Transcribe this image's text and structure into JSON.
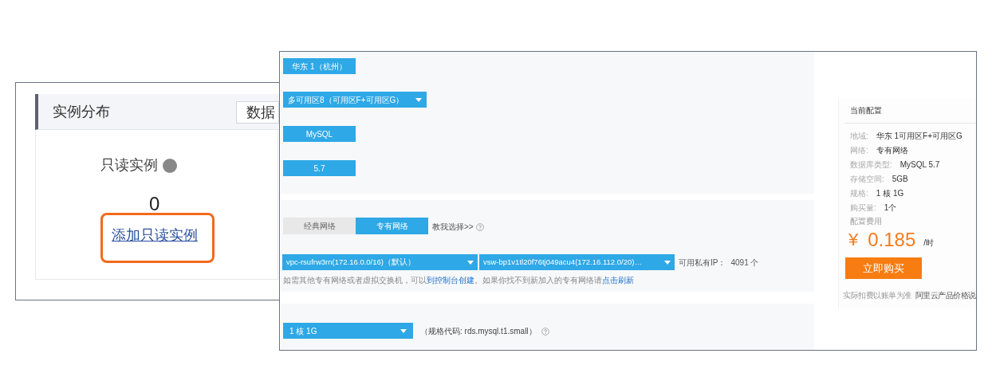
{
  "left_panel": {
    "title": "实例分布",
    "tab_partial": "数据",
    "readonly_label": "只读实例",
    "readonly_count": "0",
    "add_link": "添加只读实例"
  },
  "form": {
    "region_button": "华东 1（杭州）",
    "zone_select": "多可用区8（可用区F+可用区G）",
    "engine_button": "MySQL",
    "version_button": "5.7",
    "network_tabs": [
      {
        "label": "经典网络",
        "selected": false
      },
      {
        "label": "专有网络",
        "selected": true
      }
    ],
    "help_link": "教我选择>>",
    "vpc_select": "vpc-rsufrw3rn(172.16.0.0/16)（默认）",
    "vswitch_select": "vsw-bp1v1tl20f76tj049acu4(172.16.112.0/20)…",
    "ip_label": "可用私有IP：",
    "ip_count": "4091 个",
    "hint_parts": [
      {
        "kind": "text",
        "text": "如需其他专有网络或者虚拟交换机，可以"
      },
      {
        "kind": "link",
        "text": "到控制台创建"
      },
      {
        "kind": "text",
        "text": "。如果你找不到新加入的专有网络请"
      },
      {
        "kind": "link",
        "text": "点击刷新"
      }
    ],
    "spec_select": "1 核 1G",
    "spec_code": "（规格代码: rds.mysql.t1.small）"
  },
  "summary": {
    "title": "当前配置",
    "rows": [
      {
        "label": "地域:",
        "value": "华东 1可用区F+可用区G"
      },
      {
        "label": "网络:",
        "value": "专有网络"
      },
      {
        "label": "数据库类型:",
        "value": "MySQL 5.7"
      },
      {
        "label": "存储空间:",
        "value": "5GB"
      },
      {
        "label": "规格:",
        "value": "1 核 1G"
      },
      {
        "label": "购买量:",
        "value": "1个"
      }
    ],
    "cost_label": "配置费用",
    "currency": "¥",
    "amount": "0.185",
    "unit": "/时",
    "buy_button": "立即购买",
    "footer": "实际扣费以账单为准",
    "footer_link": "阿里云产品价格说"
  }
}
